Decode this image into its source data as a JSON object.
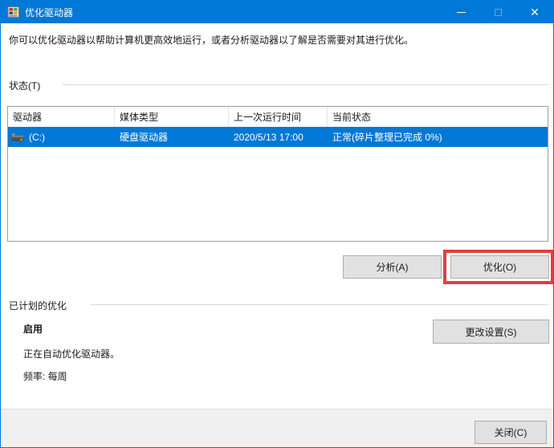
{
  "window": {
    "title": "优化驱动器",
    "controls": {
      "minimize": "minimize",
      "maximize": "maximize",
      "close_glyph": "✕"
    }
  },
  "description": "你可以优化驱动器以帮助计算机更高效地运行，或者分析驱动器以了解是否需要对其进行优化。",
  "status_section": {
    "label": "状态(T)",
    "table": {
      "columns": [
        "驱动器",
        "媒体类型",
        "上一次运行时间",
        "当前状态"
      ],
      "rows": [
        {
          "drive": "(C:)",
          "media_type": "硬盘驱动器",
          "last_run": "2020/5/13 17:00",
          "current_status": "正常(碎片整理已完成 0%)",
          "selected": true
        }
      ]
    },
    "analyze_button": "分析(A)",
    "optimize_button": "优化(O)"
  },
  "scheduled_section": {
    "label": "已计划的优化",
    "state": "启用",
    "line1": "正在自动优化驱动器。",
    "line2": "频率: 每周",
    "change_settings_button": "更改设置(S)"
  },
  "footer": {
    "close_button": "关闭(C)"
  },
  "colors": {
    "titlebar": "#0078d7",
    "selection": "#0078d7",
    "annotation_red": "#e04040",
    "footer_bg": "#f0f0f0",
    "button_bg": "#e1e1e1",
    "button_border": "#adadad"
  }
}
